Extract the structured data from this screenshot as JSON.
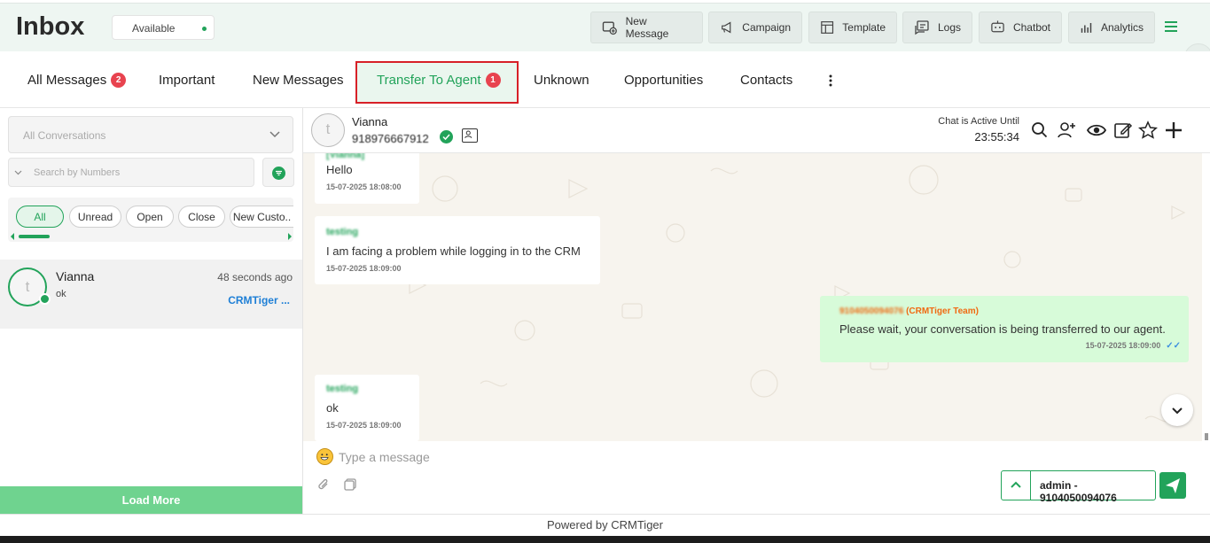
{
  "header": {
    "title": "Inbox",
    "status": "Available",
    "buttons": [
      {
        "label": "New Message",
        "icon": "new-message-icon"
      },
      {
        "label": "Campaign",
        "icon": "megaphone-icon"
      },
      {
        "label": "Template",
        "icon": "template-icon"
      },
      {
        "label": "Logs",
        "icon": "logs-icon"
      },
      {
        "label": "Chatbot",
        "icon": "chatbot-icon"
      },
      {
        "label": "Analytics",
        "icon": "analytics-icon"
      }
    ]
  },
  "tabs": [
    {
      "label": "All Messages",
      "badge": "2"
    },
    {
      "label": "Important"
    },
    {
      "label": "New Messages"
    },
    {
      "label": "Transfer To Agent",
      "badge": "1",
      "active": true
    },
    {
      "label": "Unknown"
    },
    {
      "label": "Opportunities"
    },
    {
      "label": "Contacts"
    }
  ],
  "sidebar": {
    "conversation_filter": "All Conversations",
    "search_placeholder": "Search by Numbers",
    "chips": [
      "All",
      "Unread",
      "Open",
      "Close",
      "New Custo.."
    ],
    "conversations": [
      {
        "initial": "t",
        "name": "Vianna",
        "time": "48 seconds ago",
        "message": "ok",
        "tag": "CRMTiger ..."
      }
    ],
    "load_more": "Load More"
  },
  "chat": {
    "avatar_initial": "t",
    "name": "Vianna",
    "phone": "918976667912",
    "active_label": "Chat is Active Until",
    "active_time": "23:55:34",
    "messages": [
      {
        "direction": "in",
        "sender": "[Vianna]",
        "text": "Hello",
        "time": "15-07-2025 18:08:00"
      },
      {
        "direction": "in",
        "sender": "testing",
        "text": "I am facing a problem while logging in to the CRM",
        "time": "15-07-2025 18:09:00"
      },
      {
        "direction": "out",
        "sender_number": "9104050094076",
        "sender_team": "(CRMTiger Team)",
        "text": "Please wait, your conversation is being transferred to our agent.",
        "time": "15-07-2025 18:09:00"
      },
      {
        "direction": "in",
        "sender": "testing",
        "text": "ok",
        "time": "15-07-2025 18:09:00"
      }
    ],
    "input_placeholder": "Type a message",
    "agent_label": "admin - 9104050094076"
  },
  "footer": "Powered by CRMTiger",
  "colors": {
    "accent": "#22a35a",
    "highlight_border": "#d72027",
    "badge": "#e8434f",
    "outgoing_bubble": "#d7fbd9"
  }
}
